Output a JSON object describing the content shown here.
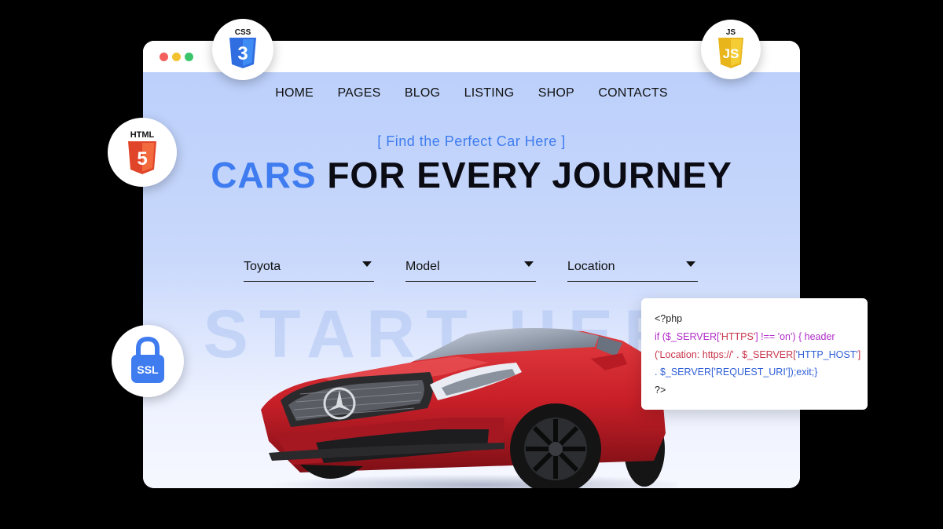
{
  "nav": {
    "items": [
      "HOME",
      "PAGES",
      "BLOG",
      "LISTING",
      "SHOP",
      "CONTACTS"
    ]
  },
  "hero": {
    "tagline": "[ Find the Perfect Car Here ]",
    "headline_accent": "CARS",
    "headline_rest": "FOR EVERY JOURNEY",
    "watermark": "START HERE"
  },
  "filters": {
    "make": "Toyota",
    "model": "Model",
    "location": "Location"
  },
  "badges": {
    "css": "CSS",
    "js": "JS",
    "html": "HTML",
    "ssl": "SSL"
  },
  "code": {
    "line1": "<?php",
    "line2a": "if ($_SERVER[",
    "line2b": "'HTTPS'",
    "line2c": "] !== 'on') { header",
    "line3a": "('Location: https://' . $_SERVER[",
    "line3b": "'HTTP_HOST'",
    "line3c": "]",
    "line4a": ". $_SERVER[",
    "line4b": "'REQUEST_URI'",
    "line4c": "]);exit;}",
    "line5": "?>"
  },
  "colors": {
    "accent": "#3f7cf0",
    "background": "#000000",
    "hero_bg": "#bcd0fb",
    "car_red": "#c8202a"
  }
}
